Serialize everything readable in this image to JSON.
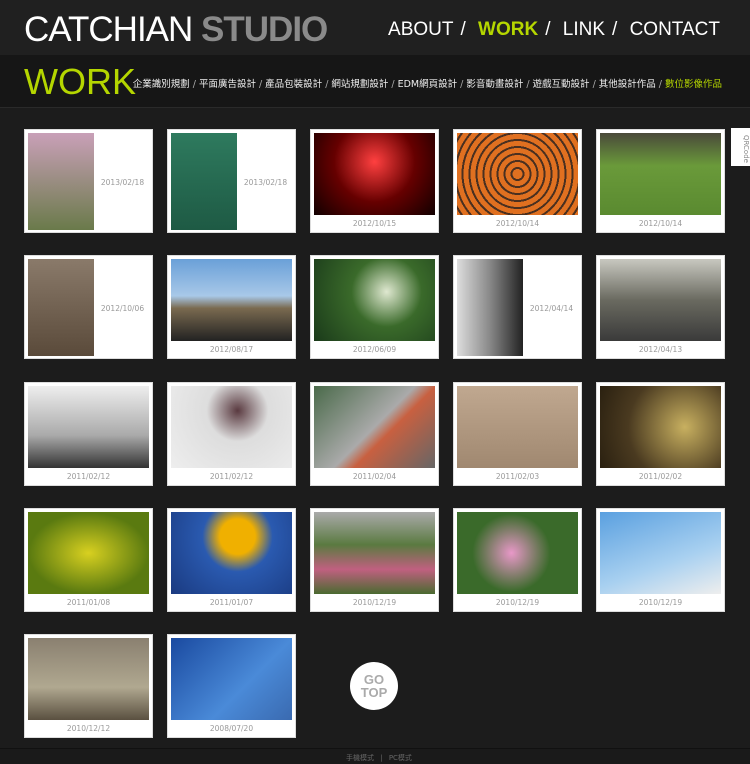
{
  "header": {
    "logo_main": "CATCHIAN",
    "logo_accent": "STUDIO",
    "nav": [
      "ABOUT",
      "WORK",
      "LINK",
      "CONTACT"
    ],
    "active_nav": "WORK"
  },
  "subheader": {
    "title": "WORK",
    "categories": [
      "企業識別規劃",
      "平面廣告設計",
      "產品包裝設計",
      "網站規劃設計",
      "EDM網頁設計",
      "影音動畫設計",
      "遊戲互動設計",
      "其他設計作品",
      "數位影像作品"
    ],
    "active_category": "數位影像作品"
  },
  "accent_color": "#b5d600",
  "qrcode_label": "QRCode",
  "gotop": {
    "line1": "GO",
    "line2": "TOP"
  },
  "footer": {
    "mobile": "手機模式",
    "separator": "|",
    "pc": "PC模式"
  },
  "gallery": [
    {
      "date": "2013/02/18",
      "portrait": true,
      "bg": "linear-gradient(#c9a0b8,#6a7a4a)"
    },
    {
      "date": "2013/02/18",
      "portrait": true,
      "bg": "linear-gradient(#2e7a5e,#1e5a44)"
    },
    {
      "date": "2012/10/15",
      "portrait": false,
      "bg": "radial-gradient(circle at 50% 35%,#ff4040,#600 50%,#100)"
    },
    {
      "date": "2012/10/14",
      "portrait": false,
      "bg": "repeating-radial-gradient(circle,#e07020 0 5px,#4a3020 5px 7px)"
    },
    {
      "date": "2012/10/14",
      "portrait": false,
      "bg": "linear-gradient(#4a4a3a,#6a9a3a 40%,#5a8a30)"
    },
    {
      "date": "2012/10/06",
      "portrait": true,
      "bg": "linear-gradient(#8a7a6a,#5a4a3a)"
    },
    {
      "date": "2012/08/17",
      "portrait": false,
      "bg": "linear-gradient(#6aa0d8,#a8c8e8 45%,#7a6a50 60%,#222)"
    },
    {
      "date": "2012/06/09",
      "portrait": false,
      "bg": "radial-gradient(circle at 60% 40%,#dfe8d0,#3a6a2a 40%,#1a3a1a)"
    },
    {
      "date": "2012/04/14",
      "portrait": true,
      "bg": "linear-gradient(90deg,#ddd,#888 50%,#222)"
    },
    {
      "date": "2012/04/13",
      "portrait": false,
      "bg": "linear-gradient(#c8c8c0,#6a6a60 50%,#3a3a3a)"
    },
    {
      "date": "2011/02/12",
      "portrait": false,
      "bg": "linear-gradient(#eee,#aaa 60%,#333)"
    },
    {
      "date": "2011/02/12",
      "portrait": false,
      "bg": "radial-gradient(circle at 55% 30%,#5a3a40,#ddd 35%,#eee)"
    },
    {
      "date": "2011/02/04",
      "portrait": false,
      "bg": "linear-gradient(135deg,#4a6a4a,#aaa 50%,#c86040 60%,#666)"
    },
    {
      "date": "2011/02/03",
      "portrait": false,
      "bg": "linear-gradient(#c0a890,#a08870)"
    },
    {
      "date": "2011/02/02",
      "portrait": false,
      "bg": "radial-gradient(circle at 70% 50%,#c8b060,#4a3a20 60%,#2a2010)"
    },
    {
      "date": "2011/01/08",
      "portrait": false,
      "bg": "radial-gradient(#d8d020,#5a7a10 70%)"
    },
    {
      "date": "2011/01/07",
      "portrait": false,
      "bg": "radial-gradient(circle at 55% 30%,#f0b000 20%,#2a5ab0 40%,#1a3a80)"
    },
    {
      "date": "2010/12/19",
      "portrait": false,
      "bg": "linear-gradient(#aaa,#5a7a40 40%,#c06080 70%,#4a6a30)"
    },
    {
      "date": "2010/12/19",
      "portrait": false,
      "bg": "radial-gradient(circle at 45% 50%,#e898c8,#3a6a2a 50%)"
    },
    {
      "date": "2010/12/19",
      "portrait": false,
      "bg": "linear-gradient(160deg,#5aa0e0,#a8d0f0 60%,#eee)"
    },
    {
      "date": "2010/12/12",
      "portrait": false,
      "bg": "linear-gradient(#8a8070,#b0a890 60%,#5a5040)"
    },
    {
      "date": "2008/07/20",
      "portrait": false,
      "bg": "linear-gradient(135deg,#1a4aa0,#4a8ad8 60%,#3a6ab0)"
    }
  ]
}
